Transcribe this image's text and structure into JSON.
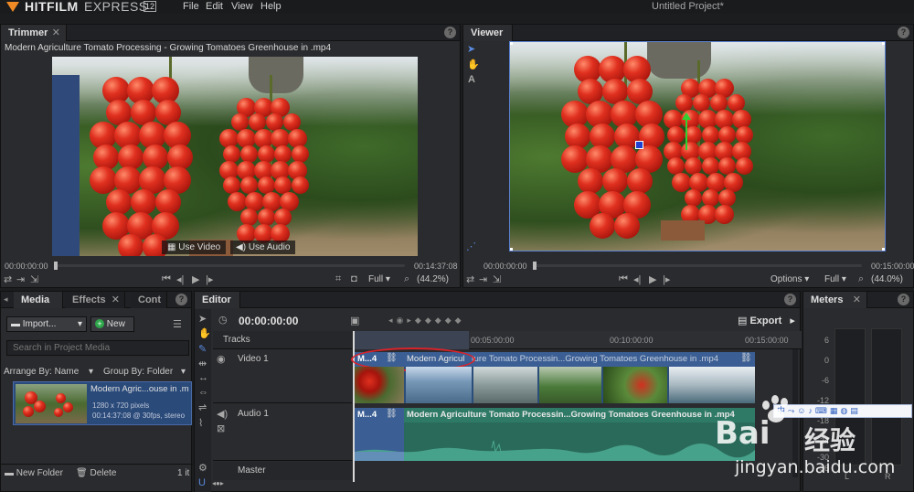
{
  "app": {
    "logo_text": "HITFILM",
    "logo_suffix": "EXPRESS",
    "version": "12",
    "project_title": "Untitled Project*",
    "menu": [
      "File",
      "Edit",
      "View",
      "Help"
    ]
  },
  "trimmer": {
    "tab_label": "Trimmer",
    "clip_title": "Modern Agriculture Tomato Processing - Growing Tomatoes Greenhouse in .mp4",
    "use_video": "Use Video",
    "use_audio": "Use Audio",
    "time_start": "00:00:00:00",
    "time_end": "00:14:37:08",
    "quality": "Full",
    "zoom": "(44.2%)",
    "playhead_fraction": 0.0
  },
  "viewer": {
    "tab_label": "Viewer",
    "time_start": "00:00:00:00",
    "time_end": "00:15:00:00",
    "options": "Options",
    "quality": "Full",
    "zoom": "(44.0%)"
  },
  "media": {
    "tabs": [
      "Media",
      "Effects",
      "Cont"
    ],
    "import_label": "Import...",
    "new_label": "New",
    "search_placeholder": "Search in Project Media",
    "arrange_label": "Arrange By: Name",
    "group_label": "Group By: Folder",
    "item": {
      "name": "Modern Agric...ouse in .m",
      "resolution": "1280 x 720 pixels",
      "details": "00:14:37:08 @ 30fps, stereo"
    },
    "new_folder": "New Folder",
    "delete": "Delete",
    "count": "1 it"
  },
  "editor": {
    "tab_label": "Editor",
    "timecode": "00:00:00:00",
    "export_label": "Export",
    "tracks_label": "Tracks",
    "ruler": [
      "00:05:00:00",
      "00:10:00:00",
      "00:15:00:00"
    ],
    "video_track": "Video 1",
    "audio_track": "Audio 1",
    "master": "Master",
    "video_clip_short": "M...4",
    "video_clip_name_a": "Modern Agricul",
    "video_clip_name_b": "ture Tomato Processin...Growing Tomatoes Greenhouse in .mp4",
    "audio_clip_short": "M...4",
    "audio_clip_name": "Modern Agriculture Tomato Processin...Growing Tomatoes Greenhouse in .mp4"
  },
  "meters": {
    "tab_label": "Meters",
    "scale": [
      "6",
      "0",
      "-6",
      "-12",
      "-18",
      "-24",
      "-30",
      "-36"
    ],
    "left": "L",
    "right": "R"
  },
  "watermark": {
    "brand": "Bai",
    "brand_cn": "经验",
    "url": "jingyan.baidu.com"
  },
  "colors": {
    "accent_orange": "#f08a24",
    "clip_blue": "#2b4d7a",
    "clip_audio": "#2a6a5a",
    "highlight_red": "#d9232a"
  }
}
